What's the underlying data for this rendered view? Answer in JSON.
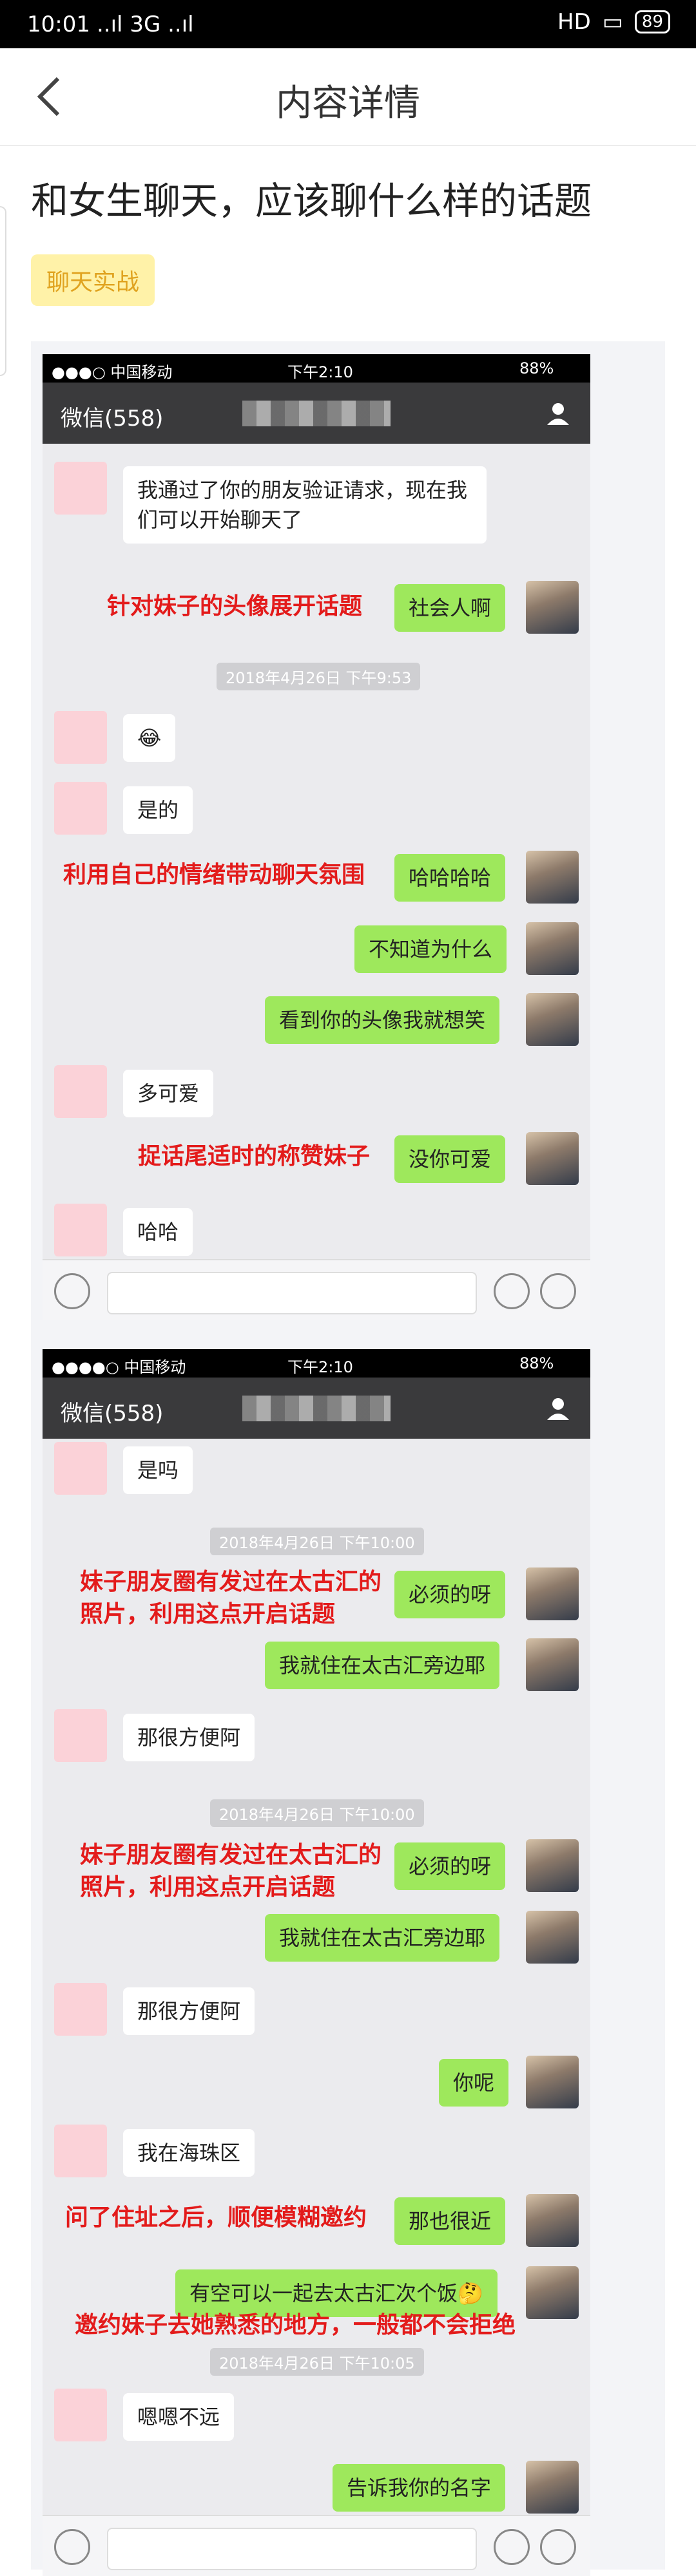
{
  "status_bar": {
    "time": "10:01",
    "signal": "..ıl 3G ..ıl",
    "network": "HD",
    "battery": "89"
  },
  "nav": {
    "title": "内容详情"
  },
  "article": {
    "title": "和女生聊天，应该聊什么样的话题",
    "tag": "聊天实战"
  },
  "shot1": {
    "status": {
      "carrier": "●●●○ 中国移动",
      "time": "下午2:10",
      "battery": "88%"
    },
    "header": {
      "back_label": "微信(558)"
    },
    "messages": [
      {
        "text": "我通过了你的朋友验证请求，现在我们可以开始聊天了"
      },
      {
        "text": "社会人啊"
      },
      {
        "text": "2018年4月26日 下午9:53"
      },
      {
        "text": "😂"
      },
      {
        "text": "是的"
      },
      {
        "text": "哈哈哈哈"
      },
      {
        "text": "不知道为什么"
      },
      {
        "text": "看到你的头像我就想笑"
      },
      {
        "text": "多可爱"
      },
      {
        "text": "没你可爱"
      },
      {
        "text": "哈哈"
      }
    ],
    "notes": [
      "针对妹子的头像展开话题",
      "利用自己的情绪带动聊天氛围",
      "捉话尾适时的称赞妹子"
    ]
  },
  "shot2": {
    "status": {
      "carrier": "●●●●○ 中国移动",
      "time": "下午2:10",
      "battery": "88%"
    },
    "header": {
      "back_label": "微信(558)"
    },
    "messages": [
      {
        "text": "是吗"
      },
      {
        "text": "2018年4月26日 下午10:00"
      },
      {
        "text": "必须的呀"
      },
      {
        "text": "我就住在太古汇旁边耶"
      },
      {
        "text": "那很方便阿"
      },
      {
        "text": "2018年4月26日 下午10:00"
      },
      {
        "text": "必须的呀"
      },
      {
        "text": "我就住在太古汇旁边耶"
      },
      {
        "text": "那很方便阿"
      },
      {
        "text": "你呢"
      },
      {
        "text": "我在海珠区"
      },
      {
        "text": "那也很近"
      },
      {
        "text": "有空可以一起去太古汇次个饭🤔"
      },
      {
        "text": "2018年4月26日 下午10:05"
      },
      {
        "text": "嗯嗯不远"
      },
      {
        "text": "告诉我你的名字"
      }
    ],
    "notes": [
      "妹子朋友圈有发过在太古汇的照片，利用这点开启话题",
      "妹子朋友圈有发过在太古汇的照片，利用这点开启话题",
      "问了住址之后，顺便模糊邀约",
      "邀约妹子去她熟悉的地方，一般都不会拒绝"
    ]
  }
}
